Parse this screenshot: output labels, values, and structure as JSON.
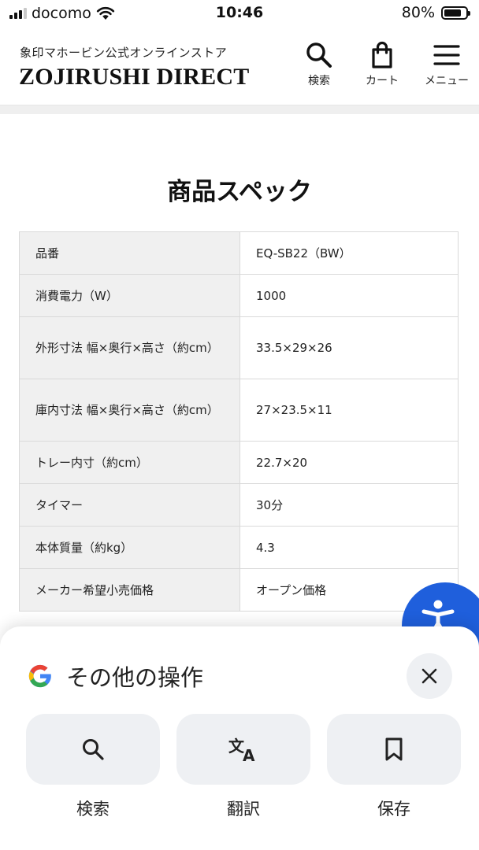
{
  "status_bar": {
    "carrier": "docomo",
    "time": "10:46",
    "battery": "80%",
    "battery_level": 0.8
  },
  "header": {
    "brand_sub": "象印マホービン公式オンラインストア",
    "brand_main": "ZOJIRUSHI DIRECT",
    "search_label": "検索",
    "cart_label": "カート",
    "menu_label": "メニュー"
  },
  "section": {
    "title": "商品スペック"
  },
  "specs": [
    {
      "key": "品番",
      "value": "EQ-SB22（BW）"
    },
    {
      "key": "消費電力（W）",
      "value": "1000"
    },
    {
      "key": "外形寸法 幅×奥行×高さ（約cm）",
      "value": "33.5×29×26"
    },
    {
      "key": "庫内寸法 幅×奥行×高さ（約cm）",
      "value": "27×23.5×11"
    },
    {
      "key": "トレー内寸（約cm）",
      "value": "22.7×20"
    },
    {
      "key": "タイマー",
      "value": "30分"
    },
    {
      "key": "本体質量（約kg）",
      "value": "4.3"
    },
    {
      "key": "メーカー希望小売価格",
      "value": "オープン価格"
    }
  ],
  "sheet": {
    "title": "その他の操作",
    "actions": [
      {
        "label": "検索",
        "icon": "search-icon"
      },
      {
        "label": "翻訳",
        "icon": "translate-icon"
      },
      {
        "label": "保存",
        "icon": "bookmark-icon"
      }
    ]
  },
  "colors": {
    "accessibility_blue": "#1f5fdc",
    "table_key_bg": "#f0f0f0",
    "sheet_button_bg": "#eef0f3"
  }
}
